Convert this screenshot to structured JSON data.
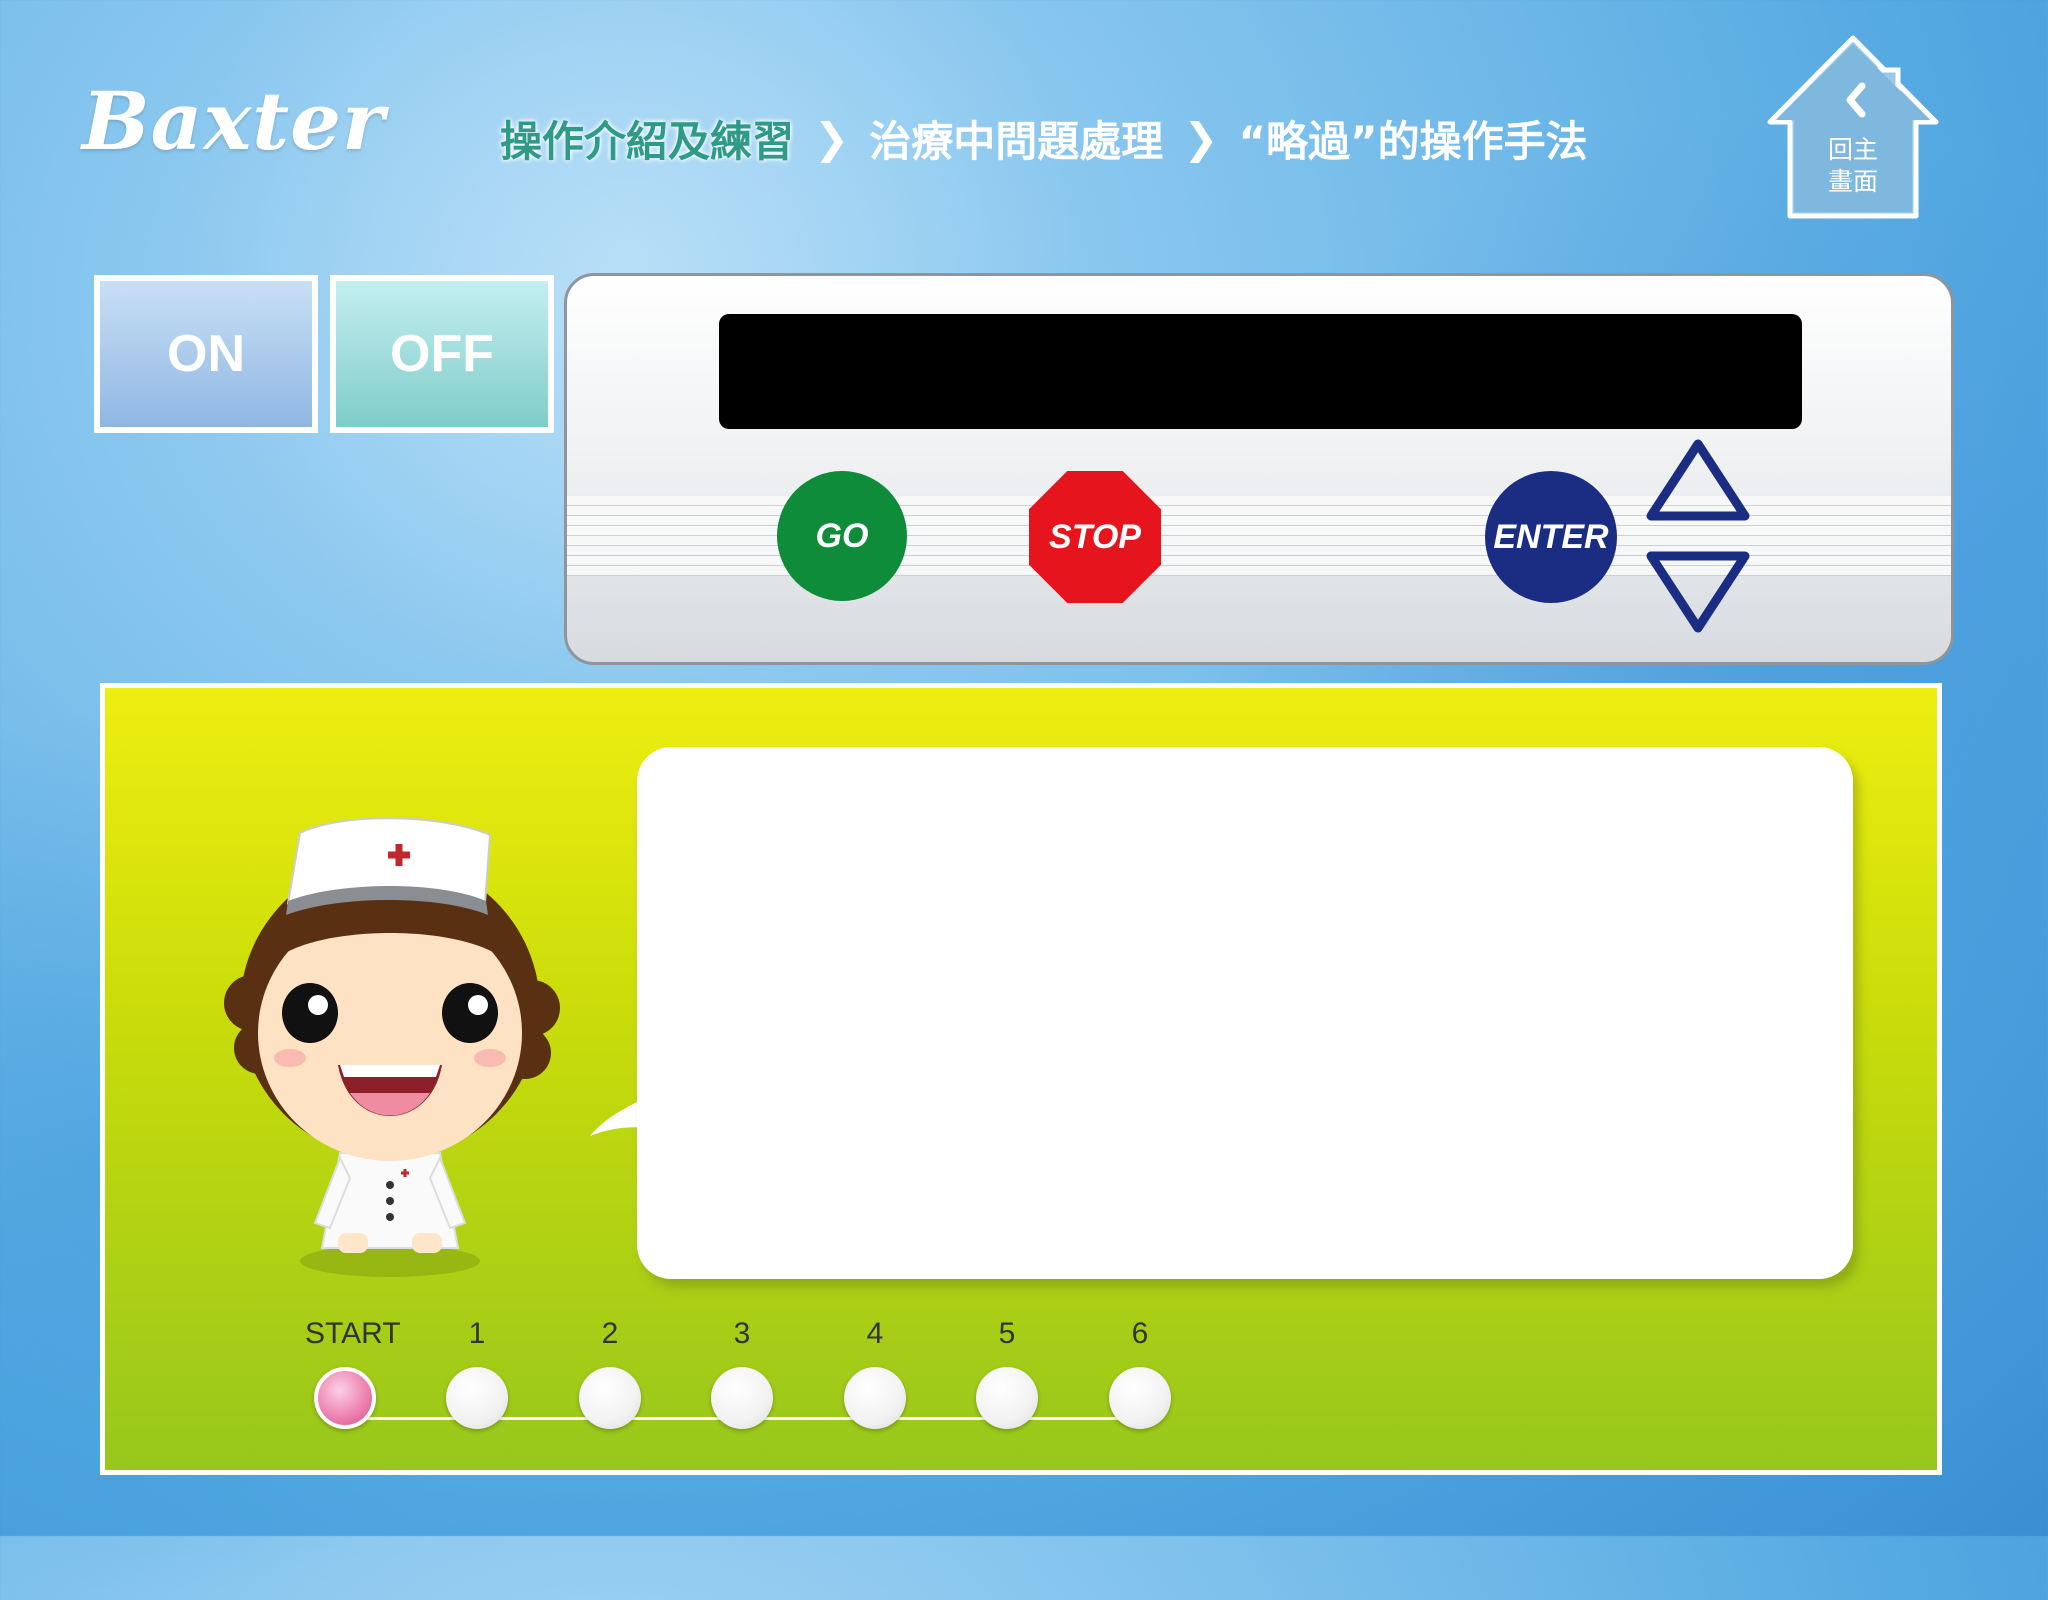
{
  "header": {
    "logo_text": "Baxter",
    "breadcrumb": [
      {
        "label": "操作介紹及練習"
      },
      {
        "label": "治療中問題處理"
      },
      {
        "label": "“略過”的操作手法"
      }
    ],
    "home_button": {
      "line1": "回主",
      "line2": "畫面"
    }
  },
  "power": {
    "on_label": "ON",
    "off_label": "OFF"
  },
  "device_panel": {
    "display_text": "",
    "go_label": "GO",
    "stop_label": "STOP",
    "enter_label": "ENTER"
  },
  "dialog": {
    "message": ""
  },
  "progress": {
    "steps": [
      "START",
      "1",
      "2",
      "3",
      "4",
      "5",
      "6"
    ],
    "current_step": "START"
  },
  "colors": {
    "breadcrumb_active": "#2f9a87",
    "go_button": "#0e8c3a",
    "stop_button": "#e6141c",
    "enter_button": "#1a2d83",
    "card_top": "#eeee10",
    "card_bottom": "#97c71c"
  }
}
